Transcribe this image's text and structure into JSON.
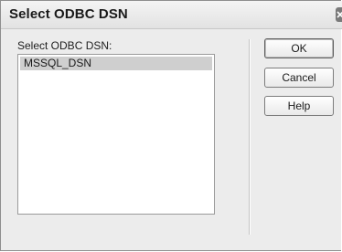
{
  "dialog": {
    "title": "Select ODBC DSN",
    "list_label": "Select ODBC DSN:",
    "items": [
      {
        "label": "MSSQL_DSN",
        "selected": true
      }
    ]
  },
  "buttons": {
    "ok_label": "OK",
    "cancel_label": "Cancel",
    "help_label": "Help"
  },
  "icons": {
    "close": "close-icon"
  },
  "colors": {
    "dialog_bg": "#ececec",
    "selection_bg": "#cfcfcf",
    "list_bg": "#ffffff"
  }
}
